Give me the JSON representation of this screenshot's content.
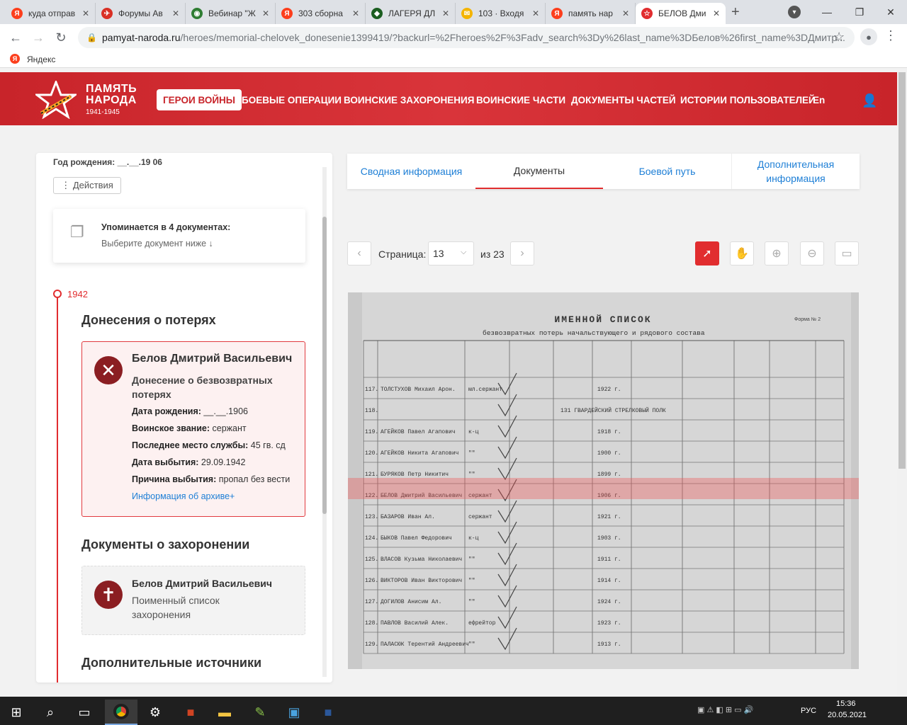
{
  "browser": {
    "tabs": [
      {
        "title": "куда отправ",
        "color": "#fc3f1d",
        "glyph": "Я"
      },
      {
        "title": "Форумы Ав",
        "color": "#d93025",
        "glyph": "✈"
      },
      {
        "title": "Вебинар \"Ж",
        "color": "#2e7d32",
        "glyph": "◉"
      },
      {
        "title": "303 сборна",
        "color": "#fc3f1d",
        "glyph": "Я"
      },
      {
        "title": "ЛАГЕРЯ ДЛ",
        "color": "#1b5e20",
        "glyph": "◆"
      },
      {
        "title": "103 · Входя",
        "color": "#f4b400",
        "glyph": "✉"
      },
      {
        "title": "память нар",
        "color": "#fc3f1d",
        "glyph": "Я"
      },
      {
        "title": "БЕЛОВ Дми",
        "color": "#e12d2f",
        "glyph": "☆"
      }
    ],
    "new_tab": "+",
    "url_host": "pamyat-naroda.ru",
    "url_path": "/heroes/memorial-chelovek_donesenie1399419/?backurl=%2Fheroes%2F%3Fadv_search%3Dy%26last_name%3DБелов%26first_name%3DДмитр...",
    "bookmark": "Яндекс"
  },
  "site": {
    "logo_line1": "ПАМЯТЬ",
    "logo_line2": "НАРОДА",
    "logo_years": "1941-1945",
    "nav": [
      "ГЕРОИ ВОЙНЫ",
      "БОЕВЫЕ ОПЕРАЦИИ",
      "ВОИНСКИЕ ЗАХОРОНЕНИЯ",
      "ВОИНСКИЕ ЧАСТИ",
      "ДОКУМЕНТЫ ЧАСТЕЙ",
      "ИСТОРИИ ПОЛЬЗОВАТЕЛЕЙ",
      "En"
    ]
  },
  "left": {
    "birth_partial": "Год рождения: __.__.19 06",
    "actions": "⋮ Действия",
    "mention_title": "Упоминается в 4 документах:",
    "mention_sub": "Выберите документ ниже",
    "year": "1942",
    "loss_section": "Донесения о потерях",
    "loss_card": {
      "name": "Белов Дмитрий Васильевич",
      "doc_type_1": "Донесение о безвозвратных",
      "doc_type_2": "потерях",
      "birth_label": "Дата рождения:",
      "birth_value": " __.__.1906",
      "rank_label": "Воинское звание:",
      "rank_value": " сержант",
      "service_label": "Последнее место службы:",
      "service_value": " 45 гв. сд",
      "leave_label": "Дата выбытия:",
      "leave_value": " 29.09.1942",
      "reason_label": "Причина выбытия:",
      "reason_value": " пропал без вести",
      "archive_link": "Информация об архиве+"
    },
    "burial_section": "Документы о захоронении",
    "burial_card": {
      "name": "Белов Дмитрий Васильевич",
      "doc_1": "Поименный список",
      "doc_2": "захоронения"
    },
    "extra_section": "Дополнительные источники"
  },
  "right": {
    "tabs": [
      "Сводная информация",
      "Документы",
      "Боевой путь",
      "Дополнительная",
      "информация"
    ],
    "page_label": "Страница:",
    "page_value": "13",
    "page_total": "из 23"
  },
  "document": {
    "title": "ИМЕННОЙ СПИСОК",
    "subtitle": "безвозвратных потерь начальствующего и рядового состава",
    "form_no": "Форма № 2",
    "rows": [
      {
        "n": "117.",
        "name": "ТОЛСТУХОВ Михаил Арон.",
        "rank": "мл.сержант",
        "year": "1922 г."
      },
      {
        "n": "118.",
        "name": "",
        "rank": "131 ГВАРДЕЙСКИЙ СТРЕЛКОВЫЙ ПОЛК",
        "year": ""
      },
      {
        "n": "119.",
        "name": "АГЕЙКОВ Павел Агапович",
        "rank": "к-ц",
        "year": "1918 г."
      },
      {
        "n": "120.",
        "name": "АГЕЙКОВ Никита Агапович",
        "rank": "\"\"",
        "year": "1900 г."
      },
      {
        "n": "121.",
        "name": "БУРЯКОВ Петр Никитич",
        "rank": "\"\"",
        "year": "1899 г."
      },
      {
        "n": "122.",
        "name": "БЕЛОВ Дмитрий Васильевич",
        "rank": "сержант",
        "year": "1906 г."
      },
      {
        "n": "123.",
        "name": "БАЗАРОВ Иван Ал.",
        "rank": "сержант",
        "year": "1921 г."
      },
      {
        "n": "124.",
        "name": "БЫКОВ Павел Федорович",
        "rank": "к-ц",
        "year": "1903 г."
      },
      {
        "n": "125.",
        "name": "ВЛАСОВ Кузьма Николаевич",
        "rank": "\"\"",
        "year": "1911 г."
      },
      {
        "n": "126.",
        "name": "ВИКТОРОВ Иван Викторович",
        "rank": "\"\"",
        "year": "1914 г."
      },
      {
        "n": "127.",
        "name": "ДОГИЛОВ Анисим Ал.",
        "rank": "\"\"",
        "year": "1924 г."
      },
      {
        "n": "128.",
        "name": "ПАВЛОВ Василий Алек.",
        "rank": "ефрейтор",
        "year": "1923 г."
      },
      {
        "n": "129.",
        "name": "ПАЛАСЮК Терентий Андреевич",
        "rank": "\"\"",
        "year": "1913 г."
      }
    ]
  },
  "taskbar": {
    "lang": "РУС",
    "time": "15:36",
    "date": "20.05.2021"
  }
}
